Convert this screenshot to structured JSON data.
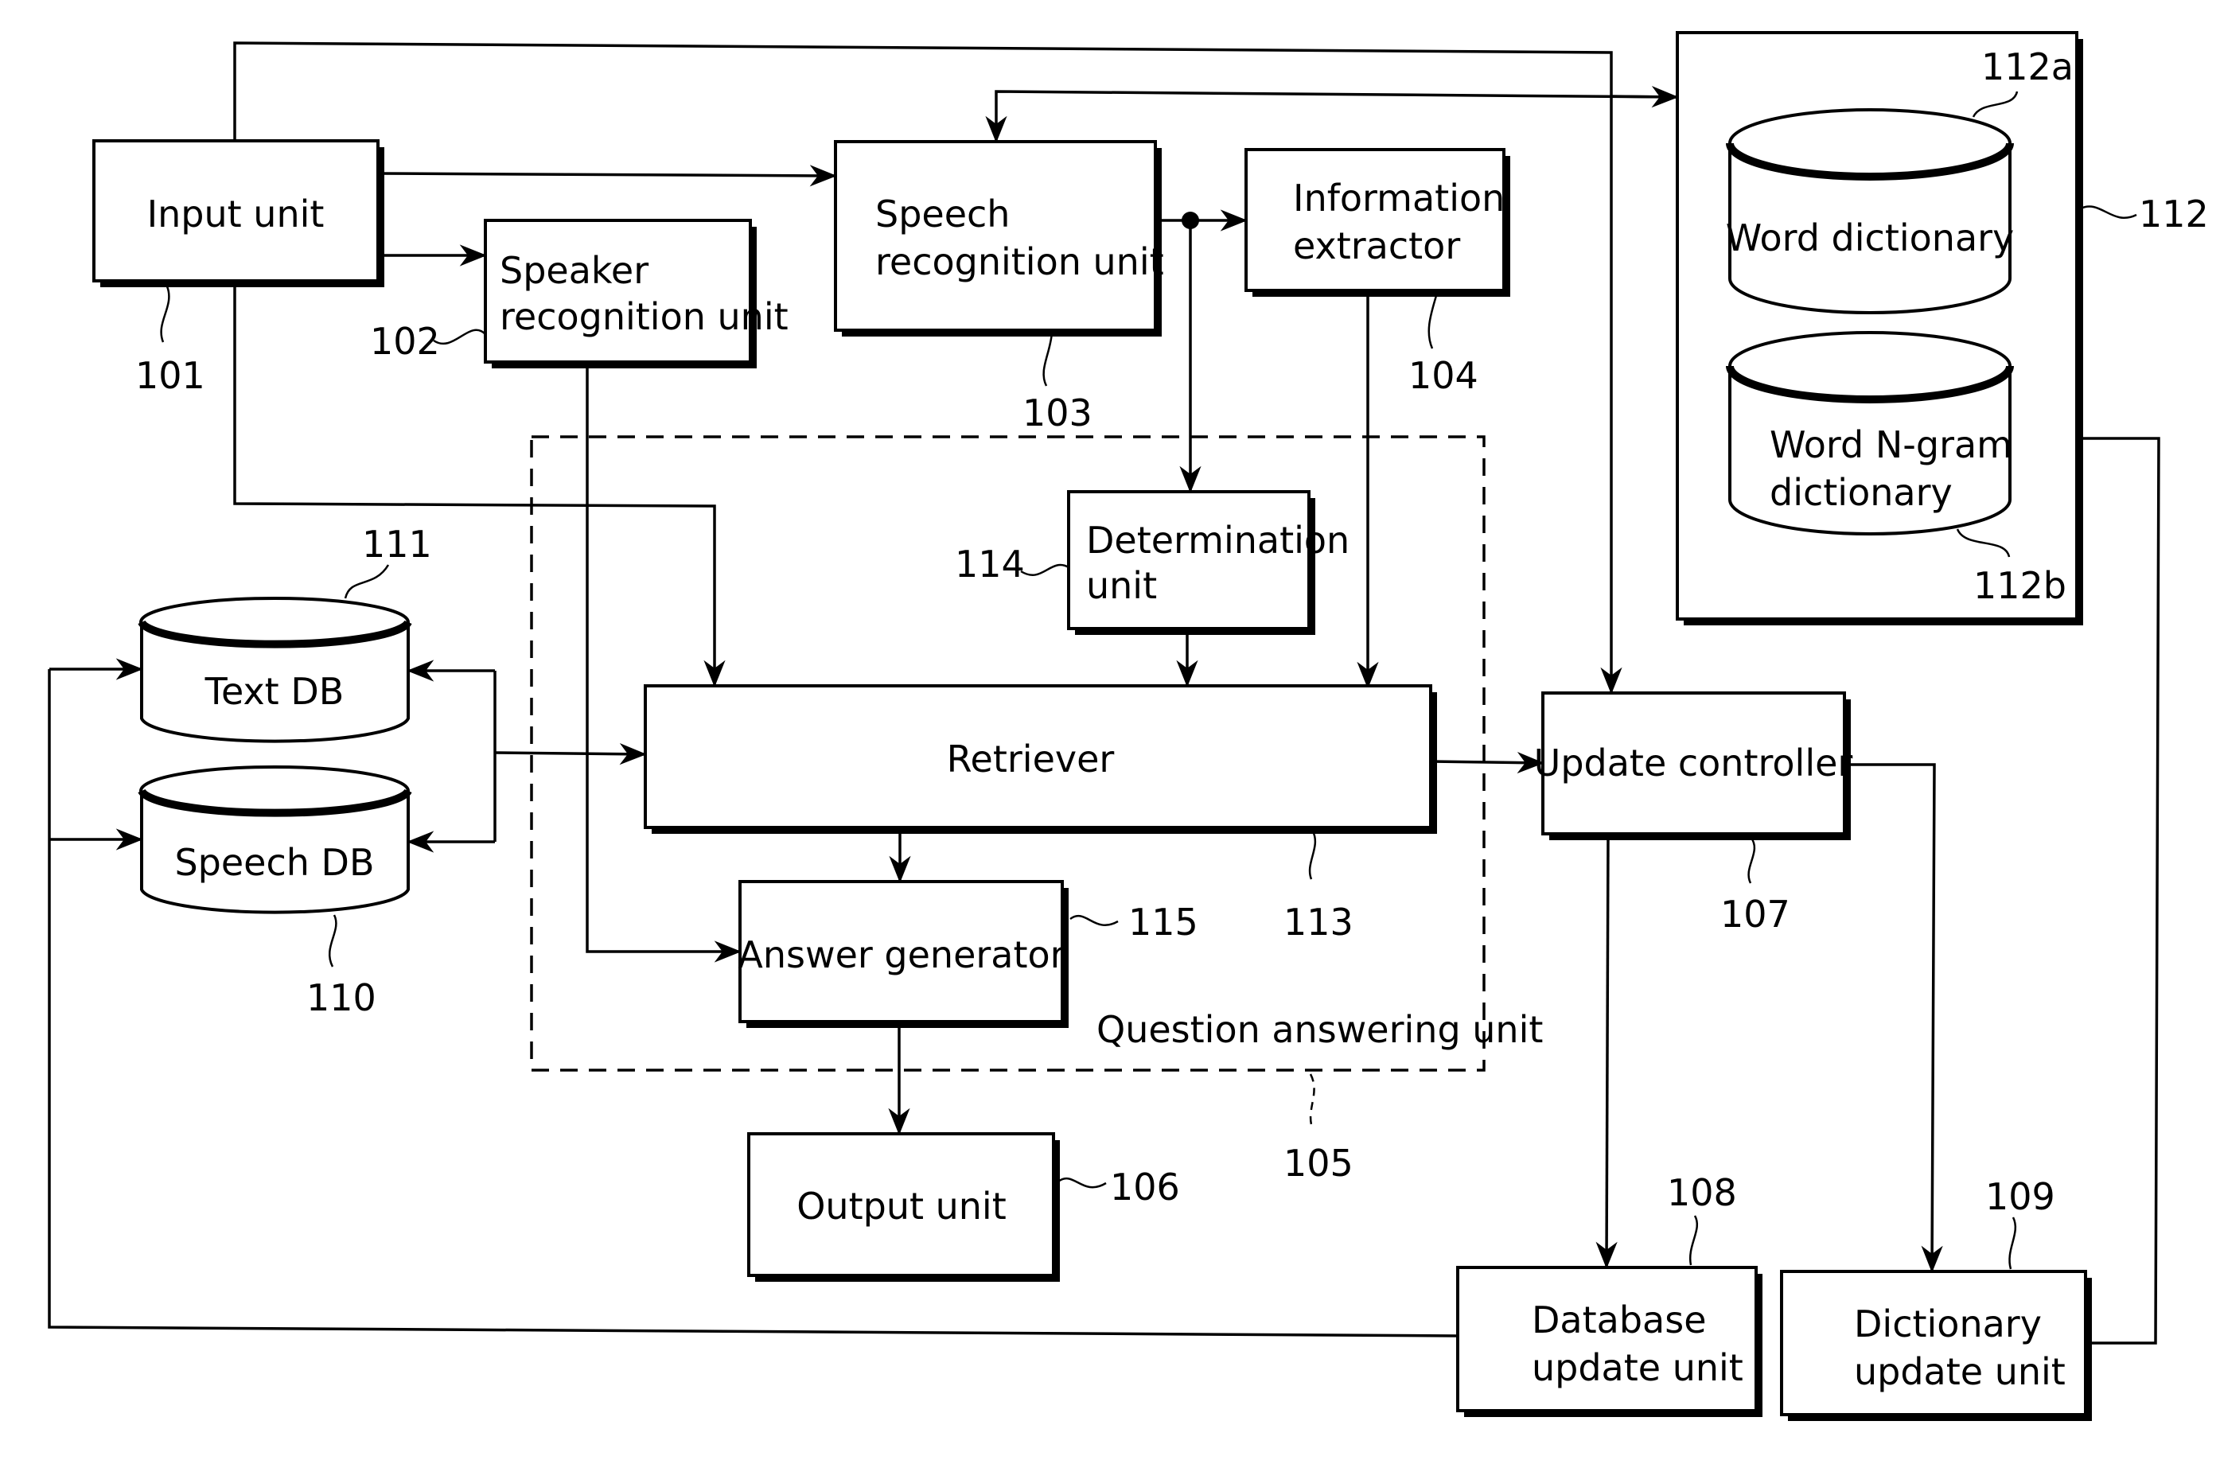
{
  "figure": {
    "blocks": {
      "input_unit": {
        "label": "Input unit",
        "ref": "101"
      },
      "speaker_recognition": {
        "line1": "Speaker",
        "line2": "recognition unit",
        "ref": "102"
      },
      "speech_recognition": {
        "line1": "Speech",
        "line2": "recognition unit",
        "ref": "103"
      },
      "information_extractor": {
        "line1": "Information",
        "line2": "extractor",
        "ref": "104"
      },
      "question_answering_unit": {
        "label": "Question answering unit",
        "ref": "105"
      },
      "output_unit": {
        "label": "Output unit",
        "ref": "106"
      },
      "update_controller": {
        "label": "Update controller",
        "ref": "107"
      },
      "database_update_unit": {
        "line1": "Database",
        "line2": "update unit",
        "ref": "108"
      },
      "dictionary_update_unit": {
        "line1": "Dictionary",
        "line2": "update unit",
        "ref": "109"
      },
      "speech_db": {
        "label": "Speech DB",
        "ref": "110"
      },
      "text_db": {
        "label": "Text DB",
        "ref": "111"
      },
      "dictionary_storage": {
        "ref": "112"
      },
      "word_dictionary": {
        "label": "Word dictionary",
        "ref": "112a"
      },
      "word_ngram_dictionary": {
        "line1": "Word N-gram",
        "line2": "dictionary",
        "ref": "112b"
      },
      "retriever": {
        "label": "Retriever",
        "ref": "113"
      },
      "determination_unit": {
        "line1": "Determination",
        "line2": "unit",
        "ref": "114"
      },
      "answer_generator": {
        "label": "Answer generator",
        "ref": "115"
      }
    }
  }
}
